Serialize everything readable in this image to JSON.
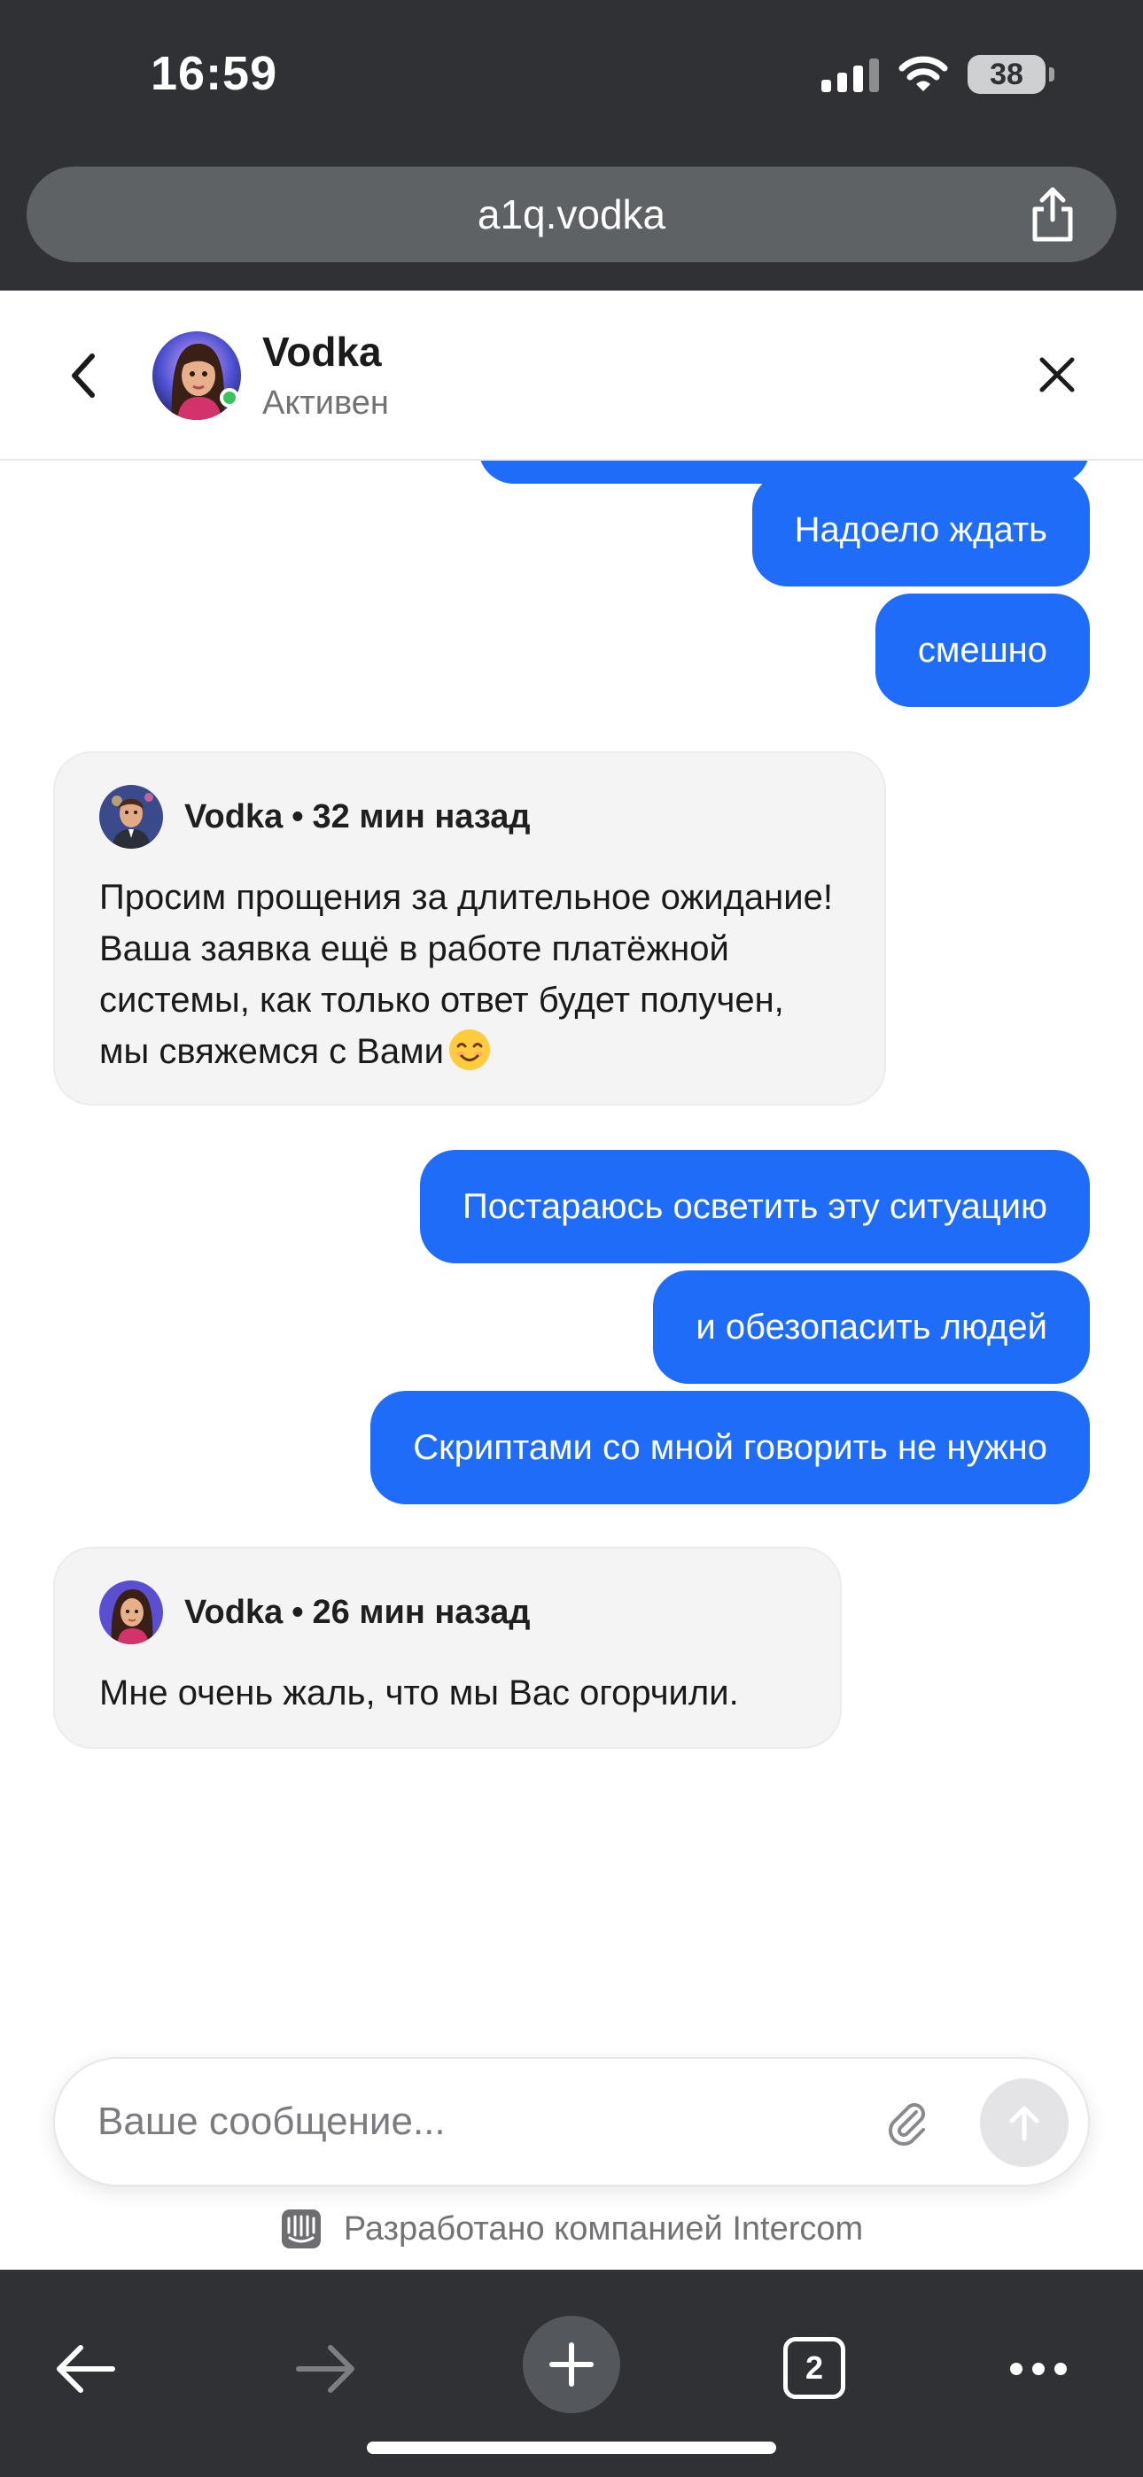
{
  "status_bar": {
    "time": "16:59",
    "battery": "38",
    "icons": [
      "signal-icon",
      "wifi-icon",
      "battery-icon"
    ]
  },
  "browser": {
    "url": "a1q.vodka",
    "tab_count": "2",
    "icons": [
      "share-icon",
      "back-arrow-icon",
      "forward-arrow-icon",
      "plus-icon",
      "tabs-icon",
      "more-icon"
    ]
  },
  "chat_header": {
    "name": "Vodka",
    "status": "Активен"
  },
  "messages": {
    "outgoing_1": "Надоело ждать",
    "outgoing_2": "смешно",
    "incoming_1": {
      "author": "Vodka",
      "time": "32 мин назад",
      "text": "Просим прощения за длительное ожидание! Ваша заявка ещё в работе платёжной системы, как только ответ будет получен, мы свяжемся с Вами"
    },
    "outgoing_3": "Постараюсь осветить эту ситуацию",
    "outgoing_4": "и обезопасить людей",
    "outgoing_5": "Скриптами со мной говорить не нужно",
    "incoming_2": {
      "author": "Vodka",
      "time": "26 мин назад",
      "text": "Мне очень жаль, что мы Вас огорчили."
    }
  },
  "composer": {
    "placeholder": "Ваше сообщение...",
    "powered_by": "Разработано компанией Intercom"
  },
  "colors": {
    "outgoing_bubble": "#1e6cf8",
    "incoming_bubble": "#f4f4f5",
    "browser_chrome": "#2f3134",
    "online": "#39c35a"
  }
}
